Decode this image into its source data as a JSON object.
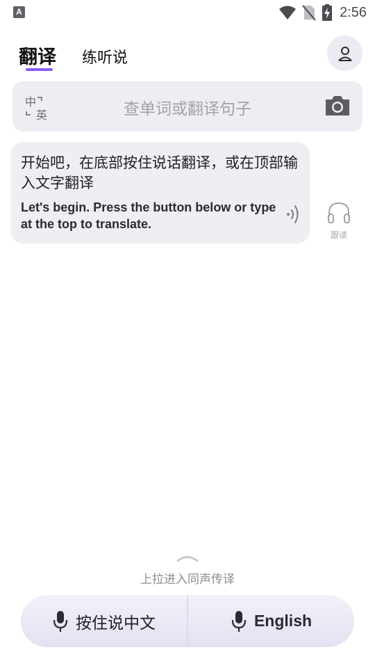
{
  "status_bar": {
    "app_icon_letter": "A",
    "time": "2:56"
  },
  "header": {
    "tabs": [
      {
        "label": "翻译",
        "active": true
      },
      {
        "label": "练听说",
        "active": false
      }
    ],
    "accent_color": "#8b5cf6"
  },
  "search": {
    "lang_from": "中",
    "lang_to": "英",
    "placeholder": "查单词或翻译句子"
  },
  "message": {
    "text_zh": "开始吧，在底部按住说话翻译，或在顶部输入文字翻译",
    "text_en": "Let's begin. Press the button below or type at the top to translate.",
    "follow_read_label": "跟读"
  },
  "bottom": {
    "pull_up_label": "上拉进入同声传译",
    "record_zh_label": "按住说中文",
    "record_en_label": "English"
  }
}
